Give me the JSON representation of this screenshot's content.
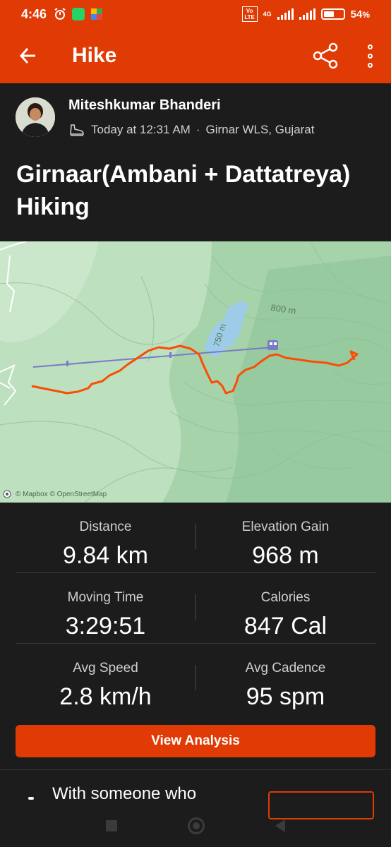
{
  "status_bar": {
    "time": "4:46",
    "left_icons": [
      "alarm-icon",
      "whatsapp-icon",
      "app-icon"
    ],
    "network": "4G",
    "volte": "Vo LTE",
    "battery_percent": "54",
    "battery_unit": "%",
    "battery_level": 0.54
  },
  "app_bar": {
    "title": "Hike",
    "back_icon": "arrow-back-icon",
    "share_icon": "share-icon",
    "more_icon": "more-vertical-icon"
  },
  "header": {
    "athlete_name": "Miteshkumar Bhanderi",
    "meta_time": "Today at 12:31 AM",
    "meta_separator": "·",
    "meta_location": "Girnar WLS, Gujarat",
    "activity_icon": "hiking-shoe-icon",
    "activity_title": "Girnaar(Ambani + Dattatreya) Hiking"
  },
  "map": {
    "contour_label_1": "800 m",
    "contour_label_2": "750 m",
    "credit": "© Mapbox © OpenStreetMap",
    "colors": {
      "terrain": "#b9dcbd",
      "water": "#9ecbe8",
      "route": "#fc4c02",
      "cable_line": "#7a7ac8"
    }
  },
  "stats": [
    {
      "label": "Distance",
      "value": "9.84 km"
    },
    {
      "label": "Elevation Gain",
      "value": "968 m"
    },
    {
      "label": "Moving Time",
      "value": "3:29:51"
    },
    {
      "label": "Calories",
      "value": "847 Cal"
    },
    {
      "label": "Avg Speed",
      "value": "2.8 km/h"
    },
    {
      "label": "Avg Cadence",
      "value": "95 spm"
    }
  ],
  "view_analysis_label": "View Analysis",
  "bottom_card": {
    "text": "With someone who"
  },
  "nav_bar": {
    "recent_icon": "square-icon",
    "home_icon": "circle-icon",
    "back_icon": "triangle-back-icon"
  },
  "colors": {
    "brand": "#e03a05",
    "background": "#1c1c1c"
  }
}
